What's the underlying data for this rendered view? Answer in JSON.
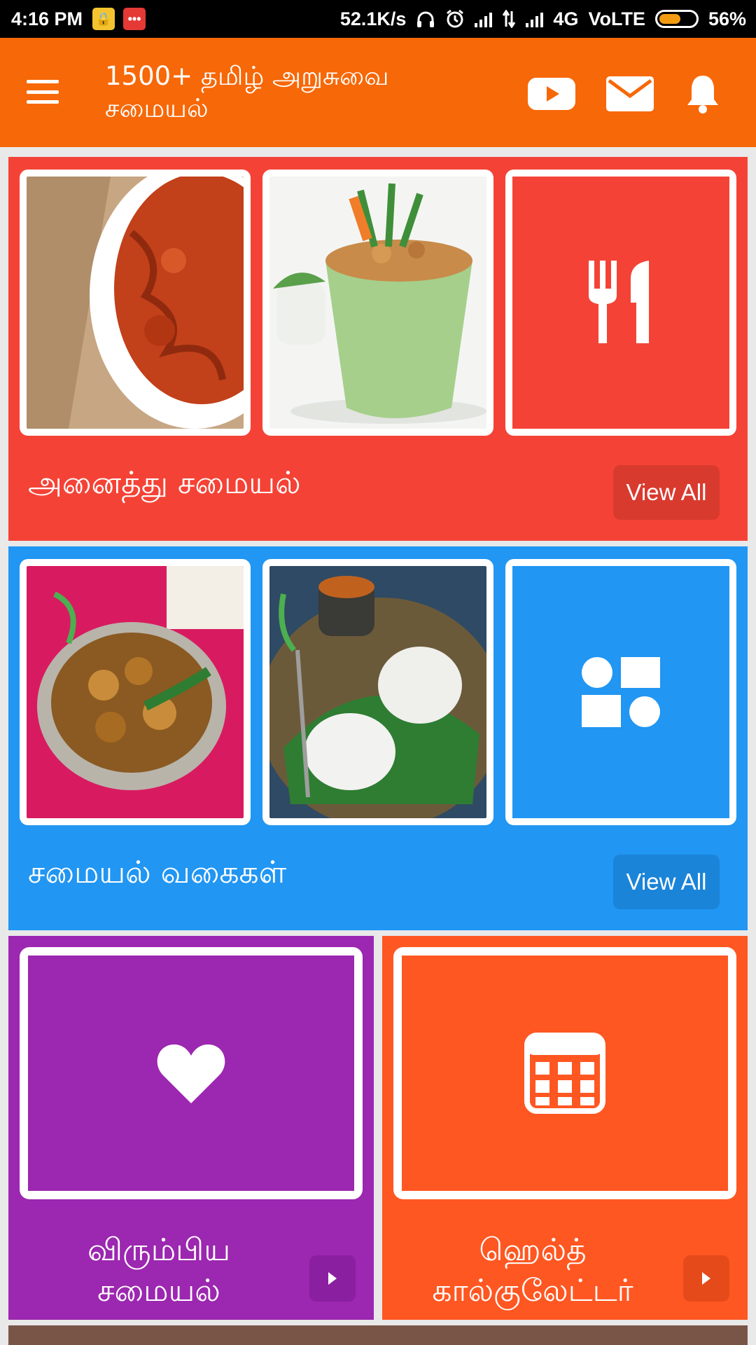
{
  "status_bar": {
    "time": "4:16 PM",
    "speed": "52.1K/s",
    "network": "4G",
    "volte": "VoLTE",
    "battery": "56%",
    "icons": [
      "lock-app-icon",
      "message-app-icon",
      "headphones-icon",
      "alarm-icon",
      "signal-icon",
      "data-arrows-icon",
      "signal-icon",
      "battery-icon"
    ]
  },
  "app_bar": {
    "title": "1500+ தமிழ் அறுசுவை சமையல்",
    "icons": [
      "menu-icon",
      "youtube-icon",
      "mail-icon",
      "bell-icon"
    ],
    "color": "#f76808"
  },
  "sections": [
    {
      "label": "அனைத்து சமையல்",
      "view_all": "View All",
      "color": "#f44336",
      "tiles": [
        "tomato-thokku-photo",
        "vegetable-rice-bowl-photo",
        "fork-knife-icon"
      ]
    },
    {
      "label": "சமையல் வகைகள்",
      "view_all": "View All",
      "color": "#2196f3",
      "tiles": [
        "potato-curry-photo",
        "puttu-plate-photo",
        "categories-shapes-icon"
      ]
    }
  ],
  "cards": [
    {
      "label": "விரும்பிய சமையல்",
      "icon": "heart-icon",
      "color": "#9c27b0"
    },
    {
      "label": "ஹெல்த் கால்குலேட்டர்",
      "icon": "calculator-icon",
      "color": "#ff5722"
    }
  ]
}
